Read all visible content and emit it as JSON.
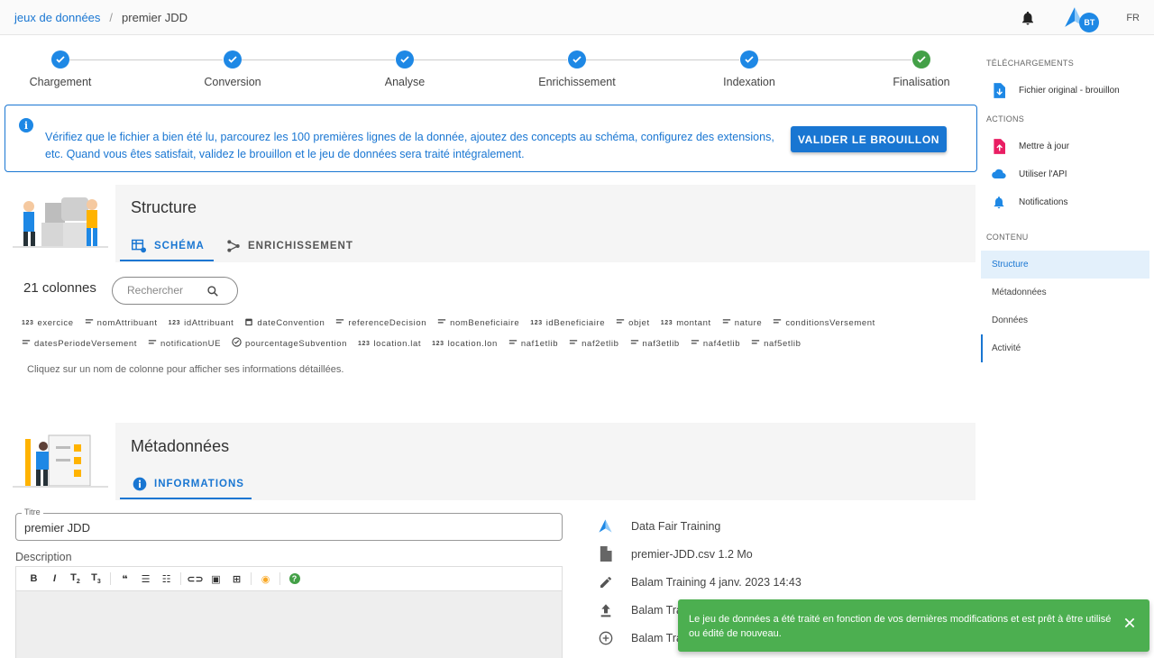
{
  "breadcrumb": {
    "parent": "jeux de données",
    "separator": "/",
    "current": "premier JDD"
  },
  "topbar": {
    "avatar_initials": "BT",
    "lang": "FR"
  },
  "stepper": {
    "steps": [
      {
        "label": "Chargement",
        "state": "done"
      },
      {
        "label": "Conversion",
        "state": "done"
      },
      {
        "label": "Analyse",
        "state": "done"
      },
      {
        "label": "Enrichissement",
        "state": "done"
      },
      {
        "label": "Indexation",
        "state": "done"
      },
      {
        "label": "Finalisation",
        "state": "complete"
      }
    ]
  },
  "alert": {
    "text": "Vérifiez que le fichier a bien été lu, parcourez les 100 premières lignes de la donnée, ajoutez des concepts au schéma, configurez des extensions, etc. Quand vous êtes satisfait, validez le brouillon et le jeu de données sera traité intégralement.",
    "button_label": "VALIDER LE BROUILLON"
  },
  "structure": {
    "title": "Structure",
    "tabs": [
      {
        "label": "SCHÉMA"
      },
      {
        "label": "ENRICHISSEMENT"
      }
    ],
    "column_count_label": "21 colonnes",
    "search_placeholder": "Rechercher",
    "columns_row1": [
      {
        "type": "num",
        "name": "exercice"
      },
      {
        "type": "text",
        "name": "nomAttribuant"
      },
      {
        "type": "num",
        "name": "idAttribuant"
      },
      {
        "type": "date",
        "name": "dateConvention"
      },
      {
        "type": "text",
        "name": "referenceDecision"
      },
      {
        "type": "text",
        "name": "nomBeneficiaire"
      },
      {
        "type": "num",
        "name": "idBeneficiaire"
      },
      {
        "type": "text",
        "name": "objet"
      },
      {
        "type": "num",
        "name": "montant"
      },
      {
        "type": "text",
        "name": "nature"
      },
      {
        "type": "text",
        "name": "conditionsVersement"
      }
    ],
    "columns_row2": [
      {
        "type": "text",
        "name": "datesPeriodeVersement"
      },
      {
        "type": "text",
        "name": "notificationUE"
      },
      {
        "type": "bool",
        "name": "pourcentageSubvention"
      },
      {
        "type": "num",
        "name": "location.lat"
      },
      {
        "type": "num",
        "name": "location.lon"
      },
      {
        "type": "text",
        "name": "naf1etlib"
      },
      {
        "type": "text",
        "name": "naf2etlib"
      },
      {
        "type": "text",
        "name": "naf3etlib"
      },
      {
        "type": "text",
        "name": "naf4etlib"
      },
      {
        "type": "text",
        "name": "naf5etlib"
      }
    ],
    "num_type_glyph": "123",
    "hint": "Cliquez sur un nom de colonne pour afficher ses informations détaillées."
  },
  "metadata": {
    "title": "Métadonnées",
    "tab_label": "INFORMATIONS",
    "title_field_label": "Titre",
    "title_field_value": "premier JDD",
    "description_label": "Description",
    "info_list": [
      {
        "icon": "datafair-logo-icon",
        "text": "Data Fair Training"
      },
      {
        "icon": "file-icon",
        "text": "premier-JDD.csv 1.2 Mo"
      },
      {
        "icon": "pencil-icon",
        "text": "Balam Training 4 janv. 2023 14:43"
      },
      {
        "icon": "upload-icon",
        "text": "Balam Tra"
      },
      {
        "icon": "plus-circle-icon",
        "text": "Balam Tra"
      }
    ]
  },
  "sidebar": {
    "downloads_heading": "TÉLÉCHARGEMENTS",
    "download_item": "Fichier original - brouillon",
    "actions_heading": "ACTIONS",
    "actions": [
      {
        "label": "Mettre à jour"
      },
      {
        "label": "Utiliser l'API"
      },
      {
        "label": "Notifications"
      }
    ],
    "content_heading": "CONTENU",
    "content_items": [
      {
        "label": "Structure"
      },
      {
        "label": "Métadonnées"
      },
      {
        "label": "Données"
      },
      {
        "label": "Activité"
      }
    ]
  },
  "snackbar": {
    "text": "Le jeu de données a été traité en fonction de vos dernières modifications et est prêt à être utilisé ou édité de nouveau."
  },
  "colors": {
    "primary": "#1976d2",
    "success": "#43a047",
    "snackbar": "#4caf50"
  }
}
